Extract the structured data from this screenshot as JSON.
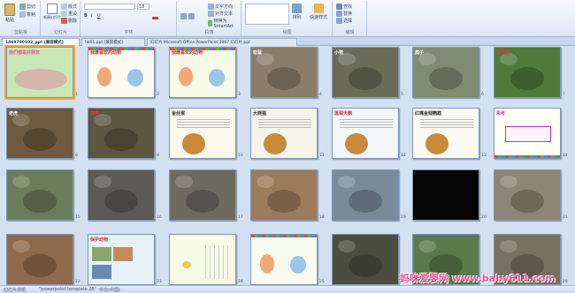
{
  "ribbon": {
    "groups": [
      {
        "label": "剪贴板"
      },
      {
        "label": "幻灯片"
      },
      {
        "label": "字体"
      },
      {
        "label": "段落"
      },
      {
        "label": "绘图"
      },
      {
        "label": "编辑"
      }
    ],
    "paste_label": "粘贴",
    "cut_label": "剪切",
    "copy_label": "复制",
    "new_slide_label": "新建幻灯片",
    "layout_label": "版式",
    "reset_label": "重设",
    "delete_label": "删除",
    "font_value": "",
    "size_value": "18",
    "text_direction_label": "文字方向",
    "align_text_label": "对齐文本",
    "convert_smartart_label": "转换为 SmartArt",
    "arrange_label": "排列",
    "quick_styles_label": "快速样式",
    "find_label": "查找",
    "replace_label": "替换",
    "select_label": "选择"
  },
  "tabs": [
    {
      "label": "1469700102_ppt [兼容模式]",
      "active": true
    },
    {
      "label": "hk01.ppt [兼容模式]",
      "active": false
    },
    {
      "label": "幻灯片 Microsoft Office PowerPoint 2007 幻灯片.ppt",
      "active": false
    }
  ],
  "slides": [
    {
      "num": "1",
      "title": "我们都是好朋友",
      "bg": "#c9e7b7",
      "accent": "#e85a9a",
      "kind": "title"
    },
    {
      "num": "2",
      "title": "我最喜欢的动物",
      "bg": "#fbfbf1",
      "accent": "#d33",
      "kind": "cartoon"
    },
    {
      "num": "3",
      "title": "我最喜欢的动物",
      "bg": "#f6fbe8",
      "accent": "#d33",
      "kind": "cartoon"
    },
    {
      "num": "4",
      "title": "松鼠",
      "bg": "#8a7e6a",
      "accent": "#fff",
      "kind": "photo"
    },
    {
      "num": "5",
      "title": "小猪",
      "bg": "#6a6c57",
      "accent": "#fff",
      "kind": "photo"
    },
    {
      "num": "6",
      "title": "鸽子",
      "bg": "#7d8c72",
      "accent": "#fff",
      "kind": "photo"
    },
    {
      "num": "7",
      "title": "梅花鹿",
      "bg": "#4f7a3a",
      "accent": "#e33",
      "kind": "photo"
    },
    {
      "num": "8",
      "title": "老虎",
      "bg": "#6e5a3c",
      "accent": "#fff",
      "kind": "photo"
    },
    {
      "num": "9",
      "title": "狮子",
      "bg": "#5d5641",
      "accent": "#e33",
      "kind": "photo"
    },
    {
      "num": "10",
      "title": "金丝猴",
      "bg": "#fbf8ec",
      "accent": "#333",
      "kind": "text"
    },
    {
      "num": "11",
      "title": "大熊猫",
      "bg": "#f4f4ea",
      "accent": "#333",
      "kind": "text"
    },
    {
      "num": "12",
      "title": "黑颈天鹅",
      "bg": "#f2f7fb",
      "accent": "#c33",
      "kind": "text"
    },
    {
      "num": "13",
      "title": "红嘴金翅鹦鹉",
      "bg": "#fbfbf3",
      "accent": "#333",
      "kind": "text"
    },
    {
      "num": "14",
      "title": "思考",
      "bg": "#fffff6",
      "accent": "#c3a",
      "kind": "question"
    },
    {
      "num": "15",
      "title": "",
      "bg": "#6b7c5a",
      "accent": "#fff",
      "kind": "photo"
    },
    {
      "num": "16",
      "title": "",
      "bg": "#5b5a55",
      "accent": "#fff",
      "kind": "photo"
    },
    {
      "num": "17",
      "title": "",
      "bg": "#6d6a60",
      "accent": "#fff",
      "kind": "photo"
    },
    {
      "num": "18",
      "title": "",
      "bg": "#9b7b5a",
      "accent": "#fff",
      "kind": "photo"
    },
    {
      "num": "19",
      "title": "",
      "bg": "#7a8a9a",
      "accent": "#fff",
      "kind": "photo"
    },
    {
      "num": "20",
      "title": "",
      "bg": "#050505",
      "accent": "#fff",
      "kind": "black"
    },
    {
      "num": "21",
      "title": "",
      "bg": "#8e8574",
      "accent": "#fff",
      "kind": "photo"
    },
    {
      "num": "22",
      "title": "",
      "bg": "#8e6a4a",
      "accent": "#fff",
      "kind": "photo"
    },
    {
      "num": "23",
      "title": "保护动物",
      "bg": "#e6f2f8",
      "accent": "#d33",
      "kind": "collage"
    },
    {
      "num": "24",
      "title": "",
      "bg": "#f6fbe8",
      "accent": "#333",
      "kind": "poem"
    },
    {
      "num": "25",
      "title": "",
      "bg": "#f8fbf0",
      "accent": "#333",
      "kind": "cartoon"
    },
    {
      "num": "26",
      "title": "",
      "bg": "#4b4e3e",
      "accent": "#ff3",
      "kind": "photo"
    },
    {
      "num": "27",
      "title": "",
      "bg": "#5a7a4a",
      "accent": "#fff",
      "kind": "photo"
    },
    {
      "num": "28",
      "title": "",
      "bg": "#7a7060",
      "accent": "#fff",
      "kind": "photo"
    }
  ],
  "status": {
    "slide_view": "幻灯片浏览",
    "template": "\"powerpoint template 28\"",
    "language": "中文(中国)"
  },
  "watermark": "妈咪爱婴网 www.baby611.com"
}
